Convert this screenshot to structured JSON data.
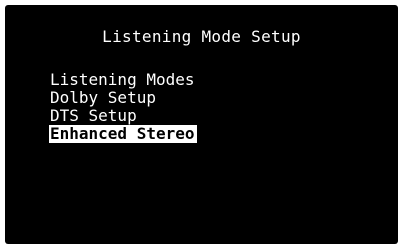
{
  "screen": {
    "title": "Listening Mode Setup",
    "menu_items": [
      {
        "label": "Listening Modes",
        "selected": false
      },
      {
        "label": "Dolby Setup",
        "selected": false
      },
      {
        "label": "DTS Setup",
        "selected": false
      },
      {
        "label": "Enhanced Stereo",
        "selected": true
      }
    ],
    "colors": {
      "background": "#000000",
      "text": "#ffffff",
      "highlight_bg": "#ffffff",
      "highlight_text": "#000000"
    }
  }
}
